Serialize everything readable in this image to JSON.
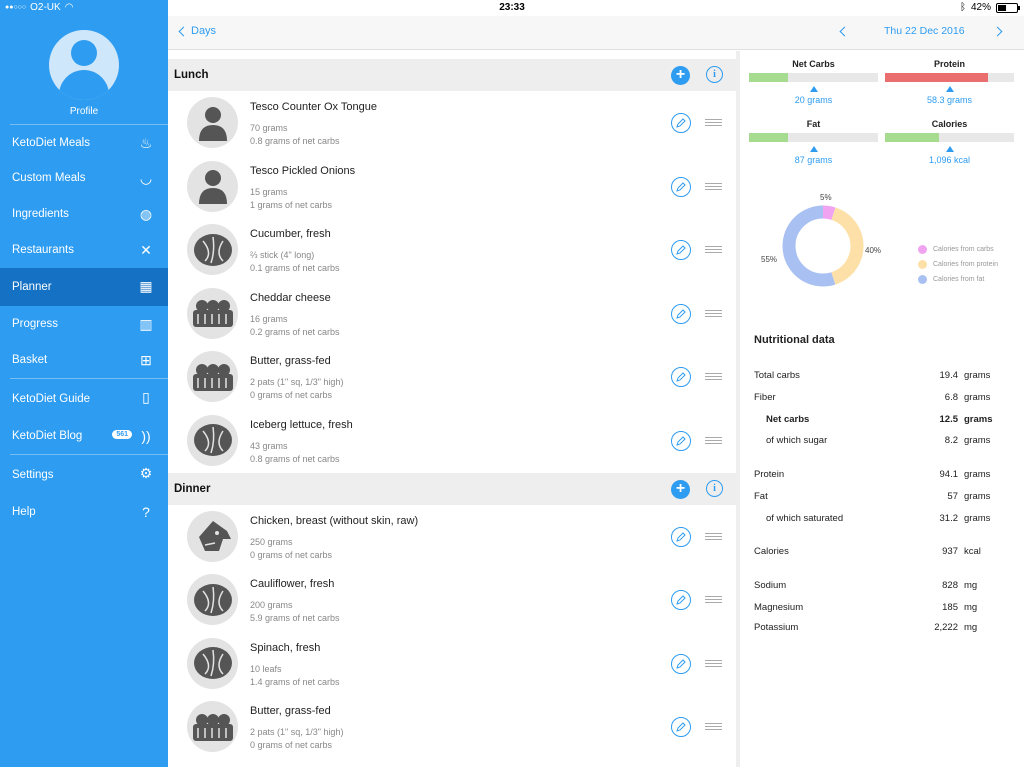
{
  "status": {
    "carrier": "O2-UK",
    "time": "23:33",
    "battery": "42%"
  },
  "sidebar": {
    "profile_label": "Profile",
    "items": [
      {
        "label": "KetoDiet Meals",
        "icon": "chef-hat-icon",
        "glyph": "♨"
      },
      {
        "label": "Custom Meals",
        "icon": "bowl-icon",
        "glyph": "◡"
      },
      {
        "label": "Ingredients",
        "icon": "egg-icon",
        "glyph": "◍"
      },
      {
        "label": "Restaurants",
        "icon": "cutlery-icon",
        "glyph": "✕"
      },
      {
        "label": "Planner",
        "icon": "calendar-icon",
        "glyph": "▦"
      },
      {
        "label": "Progress",
        "icon": "bar-chart-icon",
        "glyph": "▥"
      },
      {
        "label": "Basket",
        "icon": "basket-icon",
        "glyph": "⊞"
      },
      {
        "label": "KetoDiet Guide",
        "icon": "book-icon",
        "glyph": "▯"
      },
      {
        "label": "KetoDiet Blog",
        "icon": "rss-icon",
        "glyph": "))",
        "badge": "561"
      },
      {
        "label": "Settings",
        "icon": "gear-icon",
        "glyph": "⚙"
      },
      {
        "label": "Help",
        "icon": "help-icon",
        "glyph": "?"
      }
    ]
  },
  "topnav": {
    "back_label": "Days",
    "date": "Thu 22 Dec 2016"
  },
  "meals": [
    {
      "title": "Lunch",
      "items": [
        {
          "name": "Tesco Counter Ox Tongue",
          "amount": "70 grams",
          "carbs": "0.8 grams of net carbs",
          "icon": "person-icon"
        },
        {
          "name": "Tesco Pickled Onions",
          "amount": "15 grams",
          "carbs": "1 grams of net carbs",
          "icon": "person-icon"
        },
        {
          "name": "Cucumber, fresh",
          "amount": "⅔ stick (4\" long)",
          "carbs": "0.1 grams of net carbs",
          "icon": "vegetable-icon"
        },
        {
          "name": "Cheddar cheese",
          "amount": "16 grams",
          "carbs": "0.2 grams of net carbs",
          "icon": "dairy-icon"
        },
        {
          "name": "Butter, grass-fed",
          "amount": "2 pats (1\" sq, 1/3\" high)",
          "carbs": "0 grams of net carbs",
          "icon": "dairy-icon"
        },
        {
          "name": "Iceberg lettuce, fresh",
          "amount": "43 grams",
          "carbs": "0.8 grams of net carbs",
          "icon": "vegetable-icon"
        }
      ]
    },
    {
      "title": "Dinner",
      "items": [
        {
          "name": "Chicken, breast (without skin, raw)",
          "amount": "250 grams",
          "carbs": "0 grams of net carbs",
          "icon": "chicken-icon"
        },
        {
          "name": "Cauliflower, fresh",
          "amount": "200 grams",
          "carbs": "5.9 grams of net carbs",
          "icon": "vegetable-icon"
        },
        {
          "name": "Spinach, fresh",
          "amount": "10 leafs",
          "carbs": "1.4 grams of net carbs",
          "icon": "vegetable-icon"
        },
        {
          "name": "Butter, grass-fed",
          "amount": "2 pats (1\" sq, 1/3\" high)",
          "carbs": "0 grams of net carbs",
          "icon": "dairy-icon"
        }
      ]
    }
  ],
  "macros": [
    {
      "label": "Net Carbs",
      "value": "20 grams",
      "fill": 0.3,
      "color": "#a6dc8f"
    },
    {
      "label": "Protein",
      "value": "58.3 grams",
      "fill": 0.8,
      "color": "#ea6e6e"
    },
    {
      "label": "Fat",
      "value": "87 grams",
      "fill": 0.3,
      "color": "#a6dc8f"
    },
    {
      "label": "Calories",
      "value": "1,096 kcal",
      "fill": 0.42,
      "color": "#a6dc8f"
    }
  ],
  "donut": {
    "segments": [
      {
        "label": "Calories from carbs",
        "percent": 5,
        "color": "#f0a3f0",
        "text": "5%"
      },
      {
        "label": "Calories from protein",
        "percent": 40,
        "color": "#fde0a8",
        "text": "40%"
      },
      {
        "label": "Calories from fat",
        "percent": 55,
        "color": "#a9c0f2",
        "text": "55%"
      }
    ]
  },
  "nutrition": {
    "title": "Nutritional data",
    "rows": [
      {
        "label": "Total carbs",
        "value": "19.4",
        "unit": "grams"
      },
      {
        "label": "Fiber",
        "value": "6.8",
        "unit": "grams"
      },
      {
        "label": "Net carbs",
        "value": "12.5",
        "unit": "grams"
      },
      {
        "label": "of which sugar",
        "value": "8.2",
        "unit": "grams"
      },
      {
        "label": "Protein",
        "value": "94.1",
        "unit": "grams"
      },
      {
        "label": "Fat",
        "value": "57",
        "unit": "grams"
      },
      {
        "label": "of which saturated",
        "value": "31.2",
        "unit": "grams"
      },
      {
        "label": "Calories",
        "value": "937",
        "unit": "kcal"
      },
      {
        "label": "Sodium",
        "value": "828",
        "unit": "mg"
      },
      {
        "label": "Magnesium",
        "value": "185",
        "unit": "mg"
      },
      {
        "label": "Potassium",
        "value": "2,222",
        "unit": "mg"
      }
    ]
  }
}
